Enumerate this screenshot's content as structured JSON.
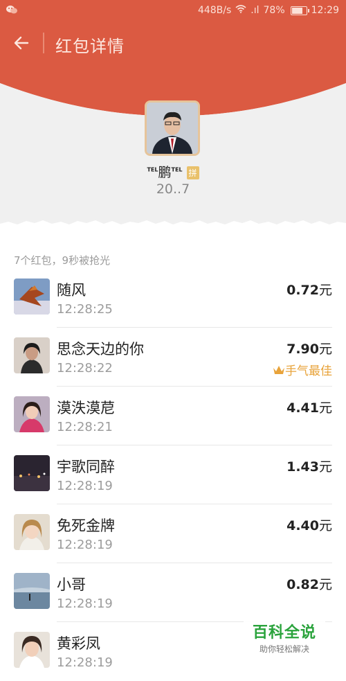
{
  "status_bar": {
    "network_speed": "448B/s",
    "signal": ".ıl",
    "battery": "78%",
    "time": "12:29",
    "icons": [
      "wechat-icon",
      "wifi-icon",
      "signal-icon",
      "battery-icon"
    ]
  },
  "toolbar": {
    "back_icon": "back-arrow-icon",
    "title": "红包详情"
  },
  "sender": {
    "name": "鹏",
    "tel_tag": "TEL",
    "badge": "拼",
    "amount": "20..7"
  },
  "summary": "7个红包，9秒被抢光",
  "records": [
    {
      "name": "随风",
      "time": "12:28:25",
      "amount": "0.72",
      "unit": "元",
      "best": ""
    },
    {
      "name": "思念天边的你",
      "time": "12:28:22",
      "amount": "7.90",
      "unit": "元",
      "best": "手气最佳"
    },
    {
      "name": "漠泆漠苨",
      "time": "12:28:21",
      "amount": "4.41",
      "unit": "元",
      "best": ""
    },
    {
      "name": "宇歌同醉",
      "time": "12:28:19",
      "amount": "1.43",
      "unit": "元",
      "best": ""
    },
    {
      "name": "免死金牌",
      "time": "12:28:19",
      "amount": "4.40",
      "unit": "元",
      "best": ""
    },
    {
      "name": "小哥",
      "time": "12:28:19",
      "amount": "0.82",
      "unit": "元",
      "best": ""
    },
    {
      "name": "黄彩凤",
      "time": "12:28:19",
      "amount": "",
      "unit": "",
      "best": ""
    }
  ],
  "watermark": {
    "title": "百科全说",
    "subtitle": "助你轻松解决"
  },
  "colors": {
    "header_red": "#db5a42",
    "best_gold": "#e8a33a",
    "avatar_border": "#e6c49a"
  }
}
